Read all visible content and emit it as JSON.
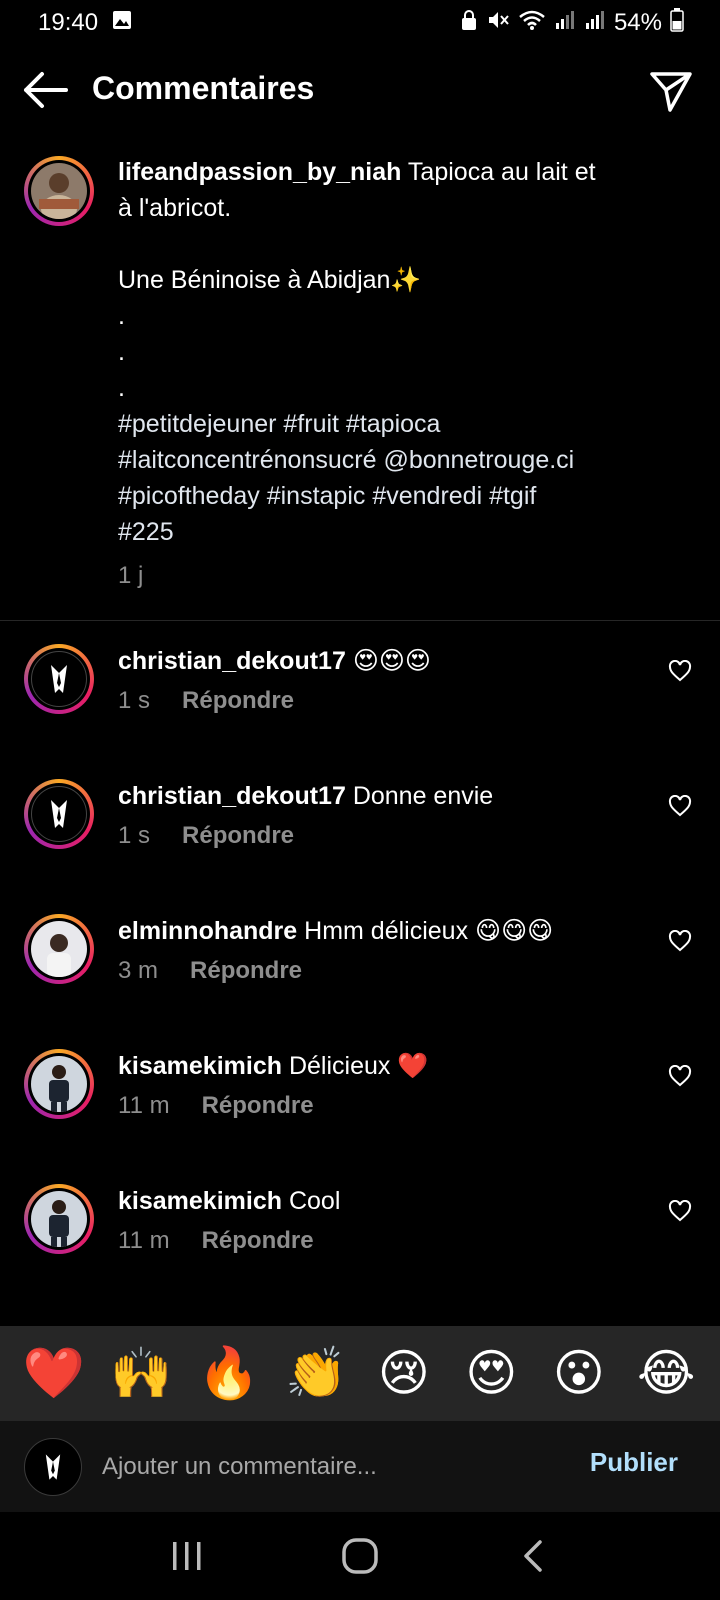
{
  "status_bar": {
    "time": "19:40",
    "battery": "54%"
  },
  "header": {
    "title": "Commentaires"
  },
  "caption": {
    "username": "lifeandpassion_by_niah",
    "lines": [
      "Tapioca au lait et",
      "à l'abricot.",
      "",
      "Une Béninoise à Abidjan✨",
      ".",
      ".",
      "."
    ],
    "hashtags": [
      "#petitdejeuner #fruit #tapioca",
      "#laitconcentrénonsucré @bonnetrouge.ci",
      "#picoftheday #instapic #vendredi #tgif",
      "#225"
    ],
    "time": "1 j"
  },
  "comments": [
    {
      "username": "christian_dekout17",
      "text": "😍😍😍",
      "time": "1 s",
      "reply_label": "Répondre"
    },
    {
      "username": "christian_dekout17",
      "text": "Donne envie",
      "time": "1 s",
      "reply_label": "Répondre"
    },
    {
      "username": "elminnohandre",
      "text": "Hmm délicieux 😋😋😋",
      "time": "3 m",
      "reply_label": "Répondre"
    },
    {
      "username": "kisamekimich",
      "text": "Délicieux ❤️",
      "time": "11 m",
      "reply_label": "Répondre"
    },
    {
      "username": "kisamekimich",
      "text": "Cool",
      "time": "11 m",
      "reply_label": "Répondre"
    }
  ],
  "emoji_bar": [
    "❤️",
    "🙌",
    "🔥",
    "👏",
    "😢",
    "😍",
    "😮",
    "😂"
  ],
  "comment_input": {
    "placeholder": "Ajouter un commentaire...",
    "publish_label": "Publier"
  },
  "colors": {
    "background": "#000000",
    "publish": "#b2dffc",
    "muted": "#8e8e8e",
    "emoji_bar_bg": "#262626"
  }
}
